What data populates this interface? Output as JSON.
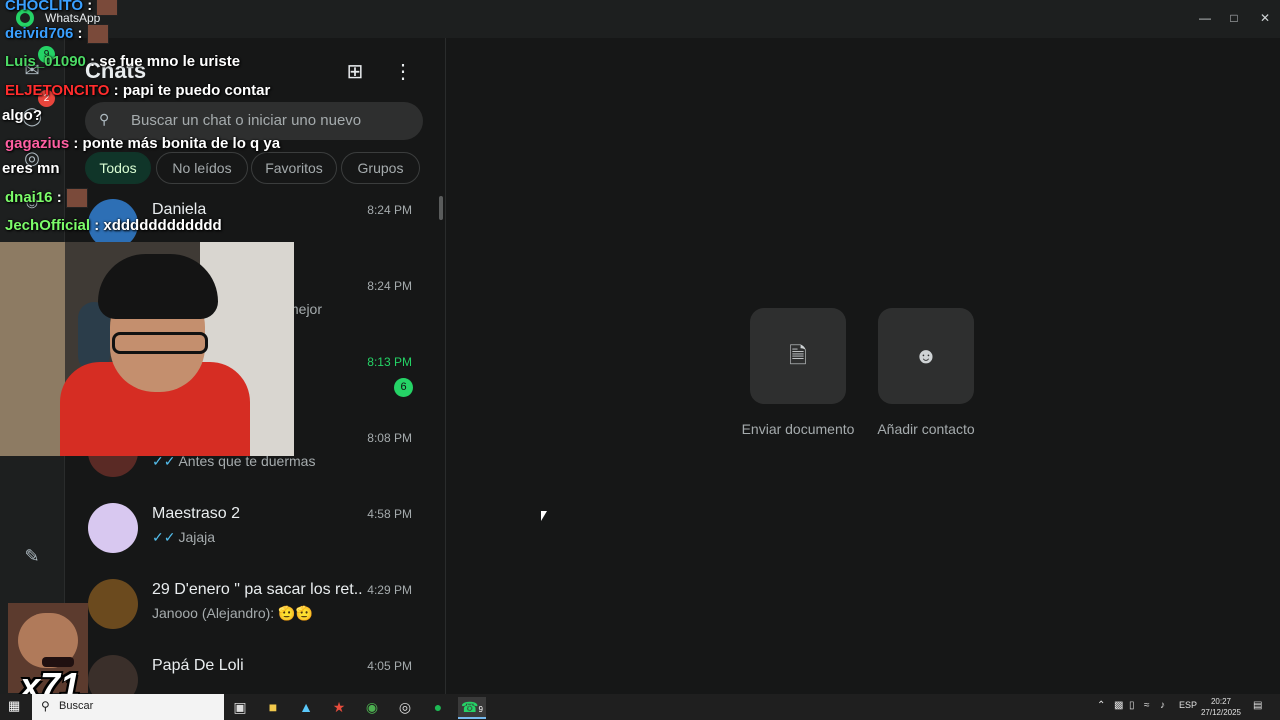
{
  "window": {
    "app_name": "WhatsApp",
    "controls": {
      "minimize": "—",
      "maximize": "□",
      "close": "✕"
    }
  },
  "rail": {
    "icons": [
      "chats-icon",
      "status-icon",
      "channels-icon",
      "communities-icon",
      "starred-icon"
    ],
    "badges": [
      "9",
      "2"
    ]
  },
  "chat_list": {
    "title": "Chats",
    "search_placeholder": "Buscar un chat o iniciar uno nuevo",
    "filters": [
      "Todos",
      "No leídos",
      "Favoritos",
      "Grupos"
    ],
    "chats": [
      {
        "name": "Daniela",
        "time": "8:24 PM",
        "preview": ""
      },
      {
        "name": "",
        "time": "8:24 PM",
        "preview": "mejor"
      },
      {
        "name": "",
        "time": "8:13 PM",
        "preview": "",
        "unread": "6"
      },
      {
        "name": "",
        "time": "8:08 PM",
        "preview": "Antes que te duermas",
        "ticks": "✓✓"
      },
      {
        "name": "Maestraso 2",
        "time": "4:58 PM",
        "preview": "Jajaja",
        "ticks": "✓✓"
      },
      {
        "name": "29 D'enero \" pa sacar los ret...",
        "time": "4:29 PM",
        "preview": "Janooo (Alejandro): 🫡🫡"
      },
      {
        "name": "Papá De Loli",
        "time": "4:05 PM",
        "preview": ""
      }
    ]
  },
  "main": {
    "actions": [
      {
        "label": "Enviar documento",
        "icon": "document-icon"
      },
      {
        "label": "Añadir contacto",
        "icon": "add-contact-icon"
      }
    ]
  },
  "stream_chat": [
    {
      "user": "CHOCLITO",
      "msg": "",
      "color": "#3aa0ff"
    },
    {
      "user": "deivid706",
      "msg": "",
      "color": "#3aa0ff"
    },
    {
      "user": "Luis_01090",
      "msg": "se fue mno le uriste",
      "color": "#4cd964"
    },
    {
      "user": "ELJETONCITO",
      "msg": "papi te puedo contar",
      "color": "#ff2d2d"
    },
    {
      "user": "",
      "msg": "algo?",
      "color": "#ffffff"
    },
    {
      "user": "gagazius",
      "msg": "ponte más bonita de lo q ya",
      "color": "#ff5fa2"
    },
    {
      "user": "",
      "msg": "eres mn",
      "color": "#ffffff"
    },
    {
      "user": "dnai16",
      "msg": "",
      "color": "#7cfc6a"
    },
    {
      "user": "JechOfficial",
      "msg": "xdddddddddddd",
      "color": "#7cfc6a"
    }
  ],
  "overlay": {
    "combo": "x71"
  },
  "taskbar": {
    "search_label": "Buscar",
    "lang": "ESP",
    "time": "20:27",
    "date": "27/12/2025",
    "whatsapp_badge": "9"
  }
}
